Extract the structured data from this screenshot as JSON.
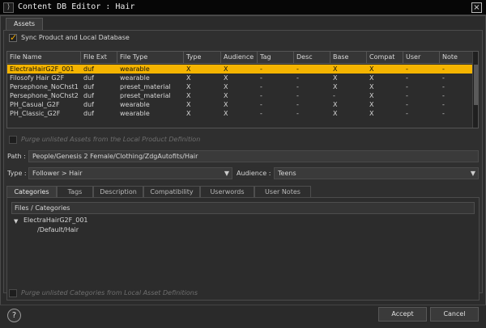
{
  "window": {
    "title": "Content DB Editor : Hair",
    "app_icon": "daz-app-icon",
    "close_icon": "close-icon"
  },
  "main_tab": "Assets",
  "sync_checkbox": {
    "label": "Sync Product and Local Database",
    "checked": true
  },
  "table": {
    "columns": [
      "File Name",
      "File Ext",
      "File Type",
      "Type",
      "Audience",
      "Tag",
      "Desc",
      "Base",
      "Compat",
      "User",
      "Note"
    ],
    "rows": [
      {
        "cells": [
          "ElectraHairG2F_001",
          "duf",
          "wearable",
          "X",
          "X",
          "-",
          "-",
          "X",
          "X",
          "-",
          "-"
        ],
        "selected": true
      },
      {
        "cells": [
          "Filosofy Hair G2F",
          "duf",
          "wearable",
          "X",
          "X",
          "-",
          "-",
          "X",
          "X",
          "-",
          "-"
        ],
        "selected": false
      },
      {
        "cells": [
          "Persephone_NoChst1",
          "duf",
          "preset_material",
          "X",
          "X",
          "-",
          "-",
          "X",
          "X",
          "-",
          "-"
        ],
        "selected": false
      },
      {
        "cells": [
          "Persephone_NoChst2",
          "duf",
          "preset_material",
          "X",
          "X",
          "-",
          "-",
          "-",
          "X",
          "-",
          "-"
        ],
        "selected": false
      },
      {
        "cells": [
          "PH_Casual_G2F",
          "duf",
          "wearable",
          "X",
          "X",
          "-",
          "-",
          "X",
          "X",
          "-",
          "-"
        ],
        "selected": false
      },
      {
        "cells": [
          "PH_Classic_G2F",
          "duf",
          "wearable",
          "X",
          "X",
          "-",
          "-",
          "X",
          "X",
          "-",
          "-"
        ],
        "selected": false
      }
    ],
    "selected_color": "#f5b400"
  },
  "purge_assets": {
    "label": "Purge unlisted Assets from the Local Product Definition",
    "checked": false,
    "enabled": false
  },
  "path": {
    "label": "Path :",
    "value": "People/Genesis 2 Female/Clothing/ZdgAutofits/Hair"
  },
  "type_field": {
    "label": "Type :",
    "value": "Follower > Hair"
  },
  "audience_field": {
    "label": "Audience :",
    "value": "Teens"
  },
  "sub_tabs": [
    "Categories",
    "Tags",
    "Description",
    "Compatibility",
    "Userwords",
    "User Notes"
  ],
  "active_sub_tab": "Categories",
  "categories": {
    "header": "Files / Categories",
    "file": "ElectraHairG2F_001",
    "category": "/Default/Hair"
  },
  "purge_categories": {
    "label": "Purge unlisted Categories from Local Asset Definitions",
    "checked": false,
    "enabled": false
  },
  "buttons": {
    "help": "?",
    "accept": "Accept",
    "cancel": "Cancel"
  }
}
